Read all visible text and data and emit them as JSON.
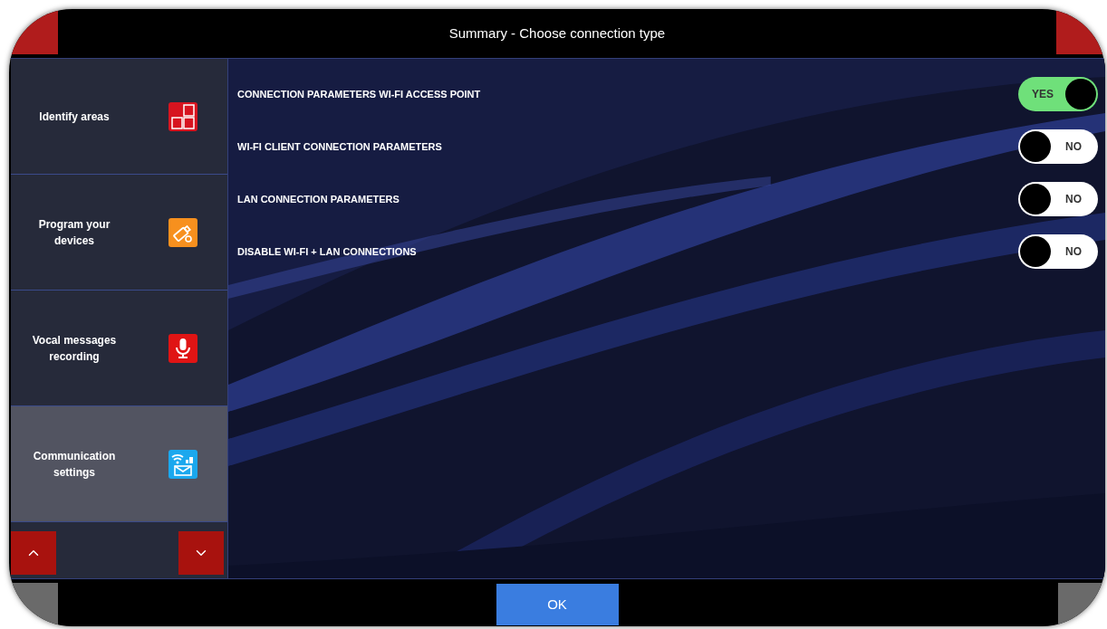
{
  "window": {
    "title": "Summary - Choose connection type"
  },
  "sidebar": {
    "items": [
      {
        "label": "Identify areas",
        "selected": false
      },
      {
        "label": "Program your devices",
        "selected": false
      },
      {
        "label": "Vocal messages recording",
        "selected": false
      },
      {
        "label": "Communication settings",
        "selected": true
      }
    ]
  },
  "options": [
    {
      "label": "CONNECTION PARAMETERS WI-FI ACCESS POINT",
      "on": true,
      "state_text": "YES"
    },
    {
      "label": "WI-FI CLIENT CONNECTION PARAMETERS",
      "on": false,
      "state_text": "NO"
    },
    {
      "label": "LAN CONNECTION PARAMETERS",
      "on": false,
      "state_text": "NO"
    },
    {
      "label": "DISABLE WI-FI + LAN CONNECTIONS",
      "on": false,
      "state_text": "NO"
    }
  ],
  "footer": {
    "ok_button": "OK"
  }
}
